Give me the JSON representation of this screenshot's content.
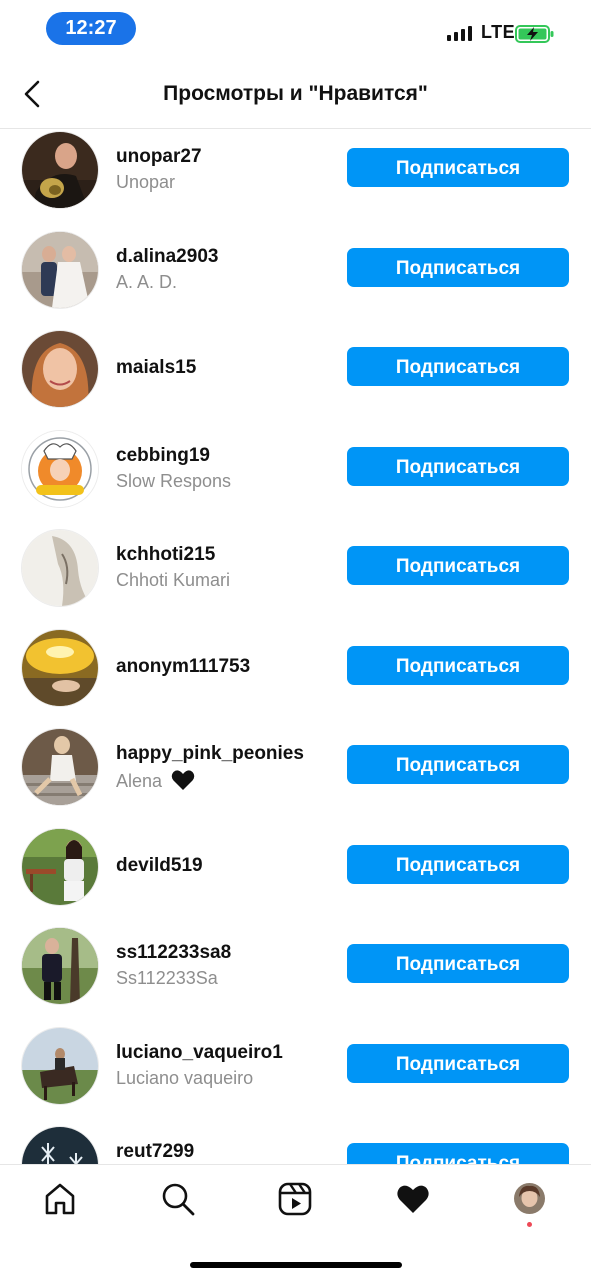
{
  "status_bar": {
    "time": "12:27",
    "network": "LTE",
    "time_pill_color": "#1a73e8",
    "battery_color": "#34c759"
  },
  "header": {
    "title": "Просмотры и \"Нравится\"",
    "back_icon": "chevron-left-icon"
  },
  "accent_color": "#0095f6",
  "follow_label": "Подписаться",
  "users": [
    {
      "username": "unopar27",
      "full_name": "Unopar"
    },
    {
      "username": "d.alina2903",
      "full_name": "A. A. D."
    },
    {
      "username": "maials15",
      "full_name": ""
    },
    {
      "username": "cebbing19",
      "full_name": "Slow Respons"
    },
    {
      "username": "kchhoti215",
      "full_name": "Chhoti Kumari"
    },
    {
      "username": "anonym111753",
      "full_name": ""
    },
    {
      "username": "happy_pink_peonies",
      "full_name": "Alena",
      "emoji": "black-heart-icon"
    },
    {
      "username": "devild519",
      "full_name": ""
    },
    {
      "username": "ss112233sa8",
      "full_name": "Ss112233Sa"
    },
    {
      "username": "luciano_vaqueiro1",
      "full_name": "Luciano vaqueiro"
    },
    {
      "username": "reut7299",
      "full_name": ""
    }
  ],
  "bottom_nav": {
    "items": [
      "home-icon",
      "search-icon",
      "reels-icon",
      "activity-heart-icon",
      "profile-avatar"
    ],
    "active": "activity-heart-icon",
    "notification_dot_color": "#ed4956"
  }
}
